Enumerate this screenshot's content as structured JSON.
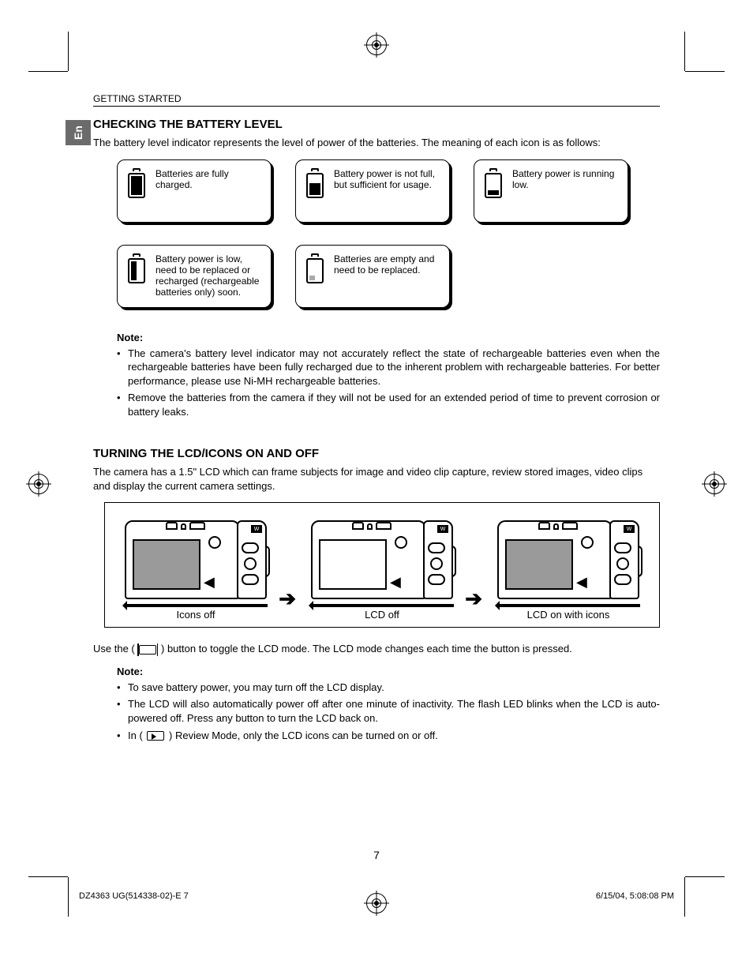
{
  "header": {
    "section": "GETTING STARTED",
    "lang_tab": "En"
  },
  "battery": {
    "heading": "CHECKING THE BATTERY LEVEL",
    "intro": "The battery level indicator represents the level of power of the batteries. The meaning of each icon is as follows:",
    "cards": [
      "Batteries are fully charged.",
      "Battery power is not full, but sufficient for usage.",
      "Battery power is running low.",
      "Battery power is low, need to be replaced or recharged (rechargeable batteries only) soon.",
      "Batteries are empty and need to be replaced."
    ],
    "note_title": "Note:",
    "notes": [
      "The camera's battery level indicator may not accurately reflect the state of rechargeable batteries even when the rechargeable batteries have been fully recharged due to the inherent problem with rechargeable batteries. For better performance, please use Ni-MH rechargeable batteries.",
      "Remove the batteries from the camera if they will not be used for an extended period of time to prevent corrosion or battery leaks."
    ]
  },
  "lcd": {
    "heading": "TURNING THE LCD/ICONS ON AND OFF",
    "intro": "The camera has a 1.5\" LCD which can frame subjects for image and video clip capture, review stored images, video clips and display the current camera settings.",
    "states": [
      "Icons off",
      "LCD off",
      "LCD on with icons"
    ],
    "usage_pre": "Use the (",
    "usage_post": ") button to toggle the LCD mode. The LCD mode changes each time the button is pressed.",
    "note_title": "Note:",
    "notes": [
      "To save battery power, you may turn off the LCD display.",
      "The LCD will also automatically power off after one minute of inactivity. The flash LED blinks when the LCD is auto-powered off.  Press any button to turn the LCD back on."
    ],
    "note3_pre": "In (",
    "note3_post": ") Review Mode, only the LCD icons can be turned on or off."
  },
  "footer": {
    "page": "7",
    "doc_left": "DZ4363 UG(514338-02)-E   7",
    "doc_right": "6/15/04, 5:08:08 PM"
  }
}
